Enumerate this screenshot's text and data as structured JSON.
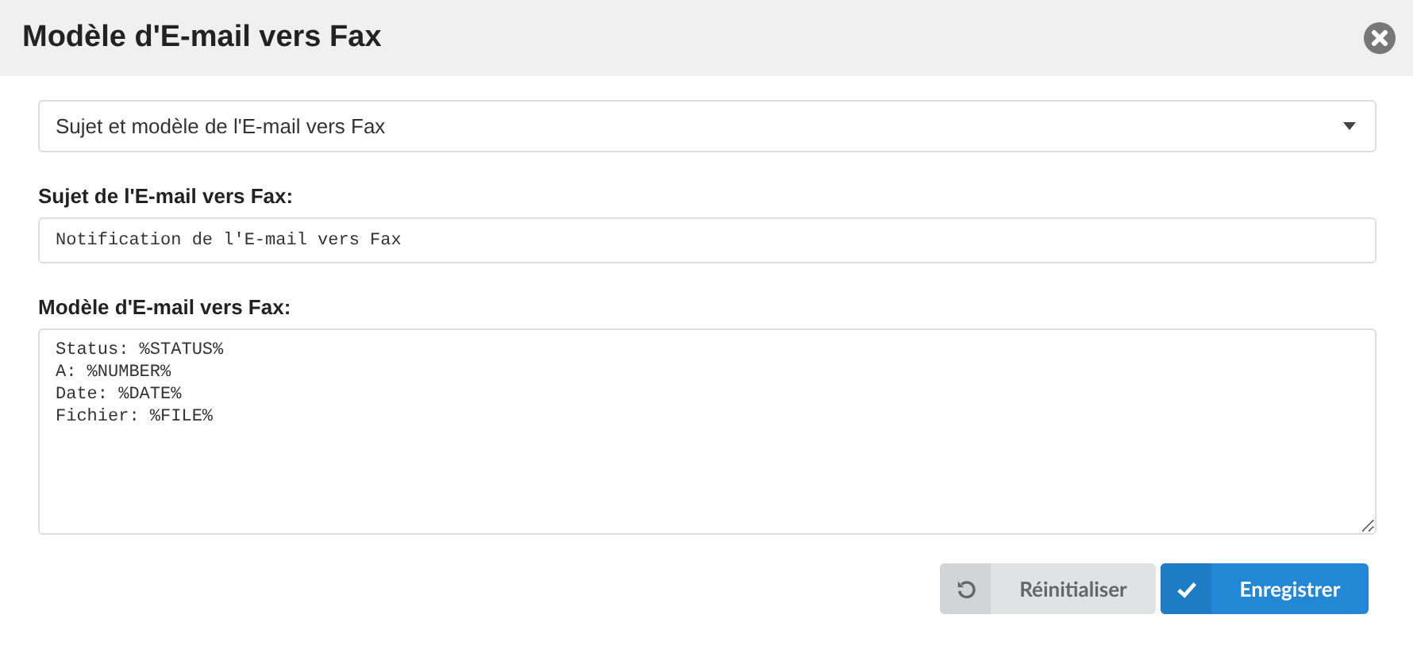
{
  "window": {
    "title": "Modèle d'E-mail vers Fax"
  },
  "section_select": {
    "value": "Sujet et modèle de l'E-mail vers Fax"
  },
  "fields": [
    {
      "kind": "input",
      "label": "Sujet de l'E-mail vers Fax:",
      "value": "Notification de l'E-mail vers Fax"
    },
    {
      "kind": "textarea",
      "label": "Modèle d'E-mail vers Fax:",
      "value": "Status: %STATUS%\nA: %NUMBER%\nDate: %DATE%\nFichier: %FILE%"
    }
  ],
  "buttons": [
    {
      "kind": "reset",
      "label": "Réinitialiser"
    },
    {
      "kind": "save",
      "label": "Enregistrer"
    }
  ]
}
